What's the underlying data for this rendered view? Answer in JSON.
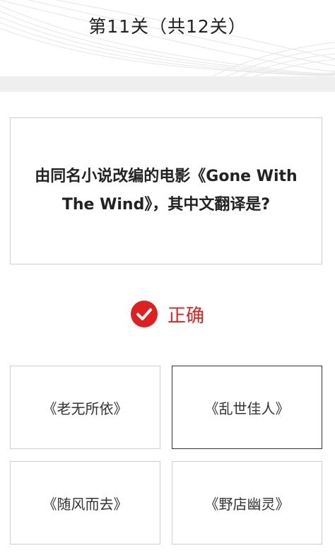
{
  "header": {
    "title": "第11关（共12关）"
  },
  "question": {
    "text": "由同名小说改编的电影《Gone With The Wind》，其中文翻译是?"
  },
  "result": {
    "icon": "check-circle-icon",
    "text": "正确",
    "color": "#e02020"
  },
  "options": [
    {
      "label": "《老无所依》",
      "selected": false
    },
    {
      "label": "《乱世佳人》",
      "selected": true
    },
    {
      "label": "《随风而去》",
      "selected": false
    },
    {
      "label": "《野店幽灵》",
      "selected": false
    }
  ],
  "colors": {
    "accent": "#e02020",
    "border": "#cfcfcf",
    "selected_border": "#333333",
    "band": "#efefef"
  }
}
